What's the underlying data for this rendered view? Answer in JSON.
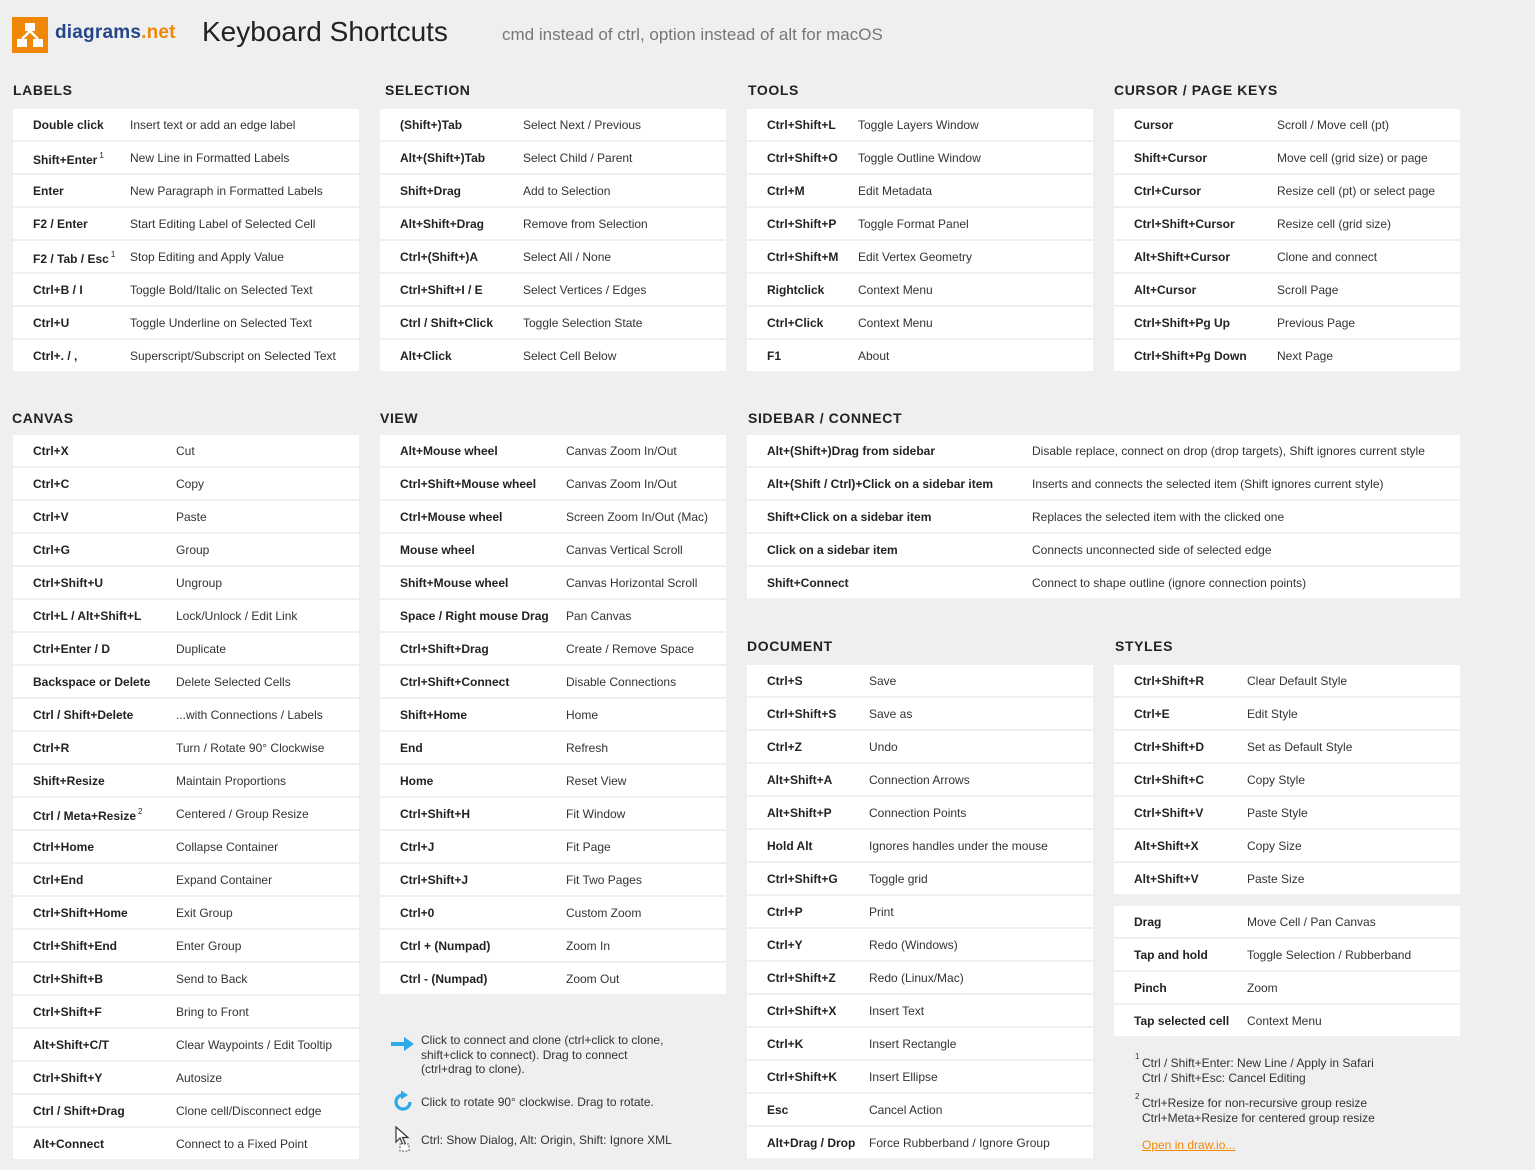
{
  "header": {
    "logo_main": "diagrams",
    "logo_ext": ".net",
    "title": "Keyboard Shortcuts",
    "subtitle": "cmd instead of ctrl, option instead of alt for macOS"
  },
  "sections": {
    "labels": {
      "title": "LABELS",
      "rows": [
        {
          "k": "Double click",
          "d": "Insert text or add an edge label"
        },
        {
          "k": "Shift+Enter",
          "sup": "1",
          "d": "New Line in Formatted Labels"
        },
        {
          "k": "Enter",
          "d": "New Paragraph in Formatted Labels"
        },
        {
          "k": "F2 / Enter",
          "d": "Start Editing Label of Selected Cell"
        },
        {
          "k": "F2 / Tab / Esc",
          "sup": "1",
          "d": "Stop Editing and Apply Value"
        },
        {
          "k": "Ctrl+B / I",
          "d": "Toggle Bold/Italic on Selected Text"
        },
        {
          "k": "Ctrl+U",
          "d": "Toggle Underline on Selected Text"
        },
        {
          "k": "Ctrl+. / ,",
          "d": "Superscript/Subscript on Selected Text"
        }
      ]
    },
    "selection": {
      "title": "SELECTION",
      "rows": [
        {
          "k": "(Shift+)Tab",
          "d": "Select Next / Previous"
        },
        {
          "k": "Alt+(Shift+)Tab",
          "d": "Select Child / Parent"
        },
        {
          "k": "Shift+Drag",
          "d": "Add to Selection"
        },
        {
          "k": "Alt+Shift+Drag",
          "d": "Remove from Selection"
        },
        {
          "k": "Ctrl+(Shift+)A",
          "d": "Select All / None"
        },
        {
          "k": "Ctrl+Shift+I / E",
          "d": "Select Vertices / Edges"
        },
        {
          "k": "Ctrl / Shift+Click",
          "d": "Toggle Selection State"
        },
        {
          "k": "Alt+Click",
          "d": "Select Cell Below"
        }
      ]
    },
    "tools": {
      "title": "TOOLS",
      "rows": [
        {
          "k": "Ctrl+Shift+L",
          "d": "Toggle Layers Window"
        },
        {
          "k": "Ctrl+Shift+O",
          "d": "Toggle Outline Window"
        },
        {
          "k": "Ctrl+M",
          "d": "Edit Metadata"
        },
        {
          "k": "Ctrl+Shift+P",
          "d": "Toggle Format Panel"
        },
        {
          "k": "Ctrl+Shift+M",
          "d": "Edit Vertex Geometry"
        },
        {
          "k": "Rightclick",
          "d": "Context Menu"
        },
        {
          "k": "Ctrl+Click",
          "d": "Context Menu"
        },
        {
          "k": "F1",
          "d": "About"
        }
      ]
    },
    "cursor": {
      "title": "CURSOR / PAGE KEYS",
      "rows": [
        {
          "k": "Cursor",
          "d": "Scroll / Move cell (pt)"
        },
        {
          "k": "Shift+Cursor",
          "d": "Move cell (grid size) or page"
        },
        {
          "k": "Ctrl+Cursor",
          "d": "Resize cell (pt) or select page"
        },
        {
          "k": "Ctrl+Shift+Cursor",
          "d": "Resize cell (grid size)"
        },
        {
          "k": "Alt+Shift+Cursor",
          "d": "Clone and connect"
        },
        {
          "k": "Alt+Cursor",
          "d": "Scroll Page"
        },
        {
          "k": "Ctrl+Shift+Pg Up",
          "d": "Previous Page"
        },
        {
          "k": "Ctrl+Shift+Pg Down",
          "d": "Next Page"
        }
      ]
    },
    "canvas": {
      "title": "CANVAS",
      "rows": [
        {
          "k": "Ctrl+X",
          "d": "Cut"
        },
        {
          "k": "Ctrl+C",
          "d": "Copy"
        },
        {
          "k": "Ctrl+V",
          "d": "Paste"
        },
        {
          "k": "Ctrl+G",
          "d": "Group"
        },
        {
          "k": "Ctrl+Shift+U",
          "d": "Ungroup"
        },
        {
          "k": "Ctrl+L / Alt+Shift+L",
          "d": "Lock/Unlock / Edit Link"
        },
        {
          "k": "Ctrl+Enter / D",
          "d": "Duplicate"
        },
        {
          "k": "Backspace or Delete",
          "d": "Delete Selected Cells"
        },
        {
          "k": "Ctrl / Shift+Delete",
          "d": "...with Connections / Labels"
        },
        {
          "k": "Ctrl+R",
          "d": "Turn / Rotate 90° Clockwise"
        },
        {
          "k": "Shift+Resize",
          "d": "Maintain Proportions"
        },
        {
          "k": "Ctrl / Meta+Resize",
          "sup": "2",
          "d": "Centered / Group Resize"
        },
        {
          "k": "Ctrl+Home",
          "d": "Collapse Container"
        },
        {
          "k": "Ctrl+End",
          "d": "Expand Container"
        },
        {
          "k": "Ctrl+Shift+Home",
          "d": "Exit Group"
        },
        {
          "k": "Ctrl+Shift+End",
          "d": "Enter Group"
        },
        {
          "k": "Ctrl+Shift+B",
          "d": "Send to Back"
        },
        {
          "k": "Ctrl+Shift+F",
          "d": "Bring to Front"
        },
        {
          "k": "Alt+Shift+C/T",
          "d": "Clear Waypoints / Edit Tooltip"
        },
        {
          "k": "Ctrl+Shift+Y",
          "d": "Autosize"
        },
        {
          "k": "Ctrl / Shift+Drag",
          "d": "Clone cell/Disconnect edge"
        },
        {
          "k": "Alt+Connect",
          "d": "Connect to a Fixed Point"
        }
      ]
    },
    "view": {
      "title": "VIEW",
      "rows": [
        {
          "k": "Alt+Mouse wheel",
          "d": "Canvas Zoom In/Out"
        },
        {
          "k": "Ctrl+Shift+Mouse wheel",
          "d": "Canvas Zoom In/Out"
        },
        {
          "k": "Ctrl+Mouse wheel",
          "d": "Screen Zoom In/Out (Mac)"
        },
        {
          "k": "Mouse wheel",
          "d": "Canvas Vertical Scroll"
        },
        {
          "k": "Shift+Mouse wheel",
          "d": "Canvas Horizontal Scroll"
        },
        {
          "k": "Space / Right mouse Drag",
          "d": "Pan Canvas"
        },
        {
          "k": "Ctrl+Shift+Drag",
          "d": "Create / Remove Space"
        },
        {
          "k": "Ctrl+Shift+Connect",
          "d": "Disable Connections"
        },
        {
          "k": "Shift+Home",
          "d": "Home"
        },
        {
          "k": "End",
          "d": "Refresh"
        },
        {
          "k": "Home",
          "d": "Reset View"
        },
        {
          "k": "Ctrl+Shift+H",
          "d": "Fit Window"
        },
        {
          "k": "Ctrl+J",
          "d": "Fit Page"
        },
        {
          "k": "Ctrl+Shift+J",
          "d": "Fit Two Pages"
        },
        {
          "k": "Ctrl+0",
          "d": "Custom Zoom"
        },
        {
          "k": "Ctrl + (Numpad)",
          "d": "Zoom In"
        },
        {
          "k": "Ctrl - (Numpad)",
          "d": "Zoom Out"
        }
      ]
    },
    "sidebar": {
      "title": "SIDEBAR / CONNECT",
      "rows": [
        {
          "k": "Alt+(Shift+)Drag from sidebar",
          "d": "Disable replace, connect on drop (drop targets), Shift ignores current style"
        },
        {
          "k": "Alt+(Shift / Ctrl)+Click on a sidebar item",
          "d": "Inserts and connects the selected item (Shift ignores current style)"
        },
        {
          "k": "Shift+Click on a sidebar item",
          "d": "Replaces the selected item with the clicked one"
        },
        {
          "k": "Click on a sidebar item",
          "d": "Connects unconnected side of selected edge"
        },
        {
          "k": "Shift+Connect",
          "d": "Connect to shape outline (ignore connection points)"
        }
      ]
    },
    "document": {
      "title": "DOCUMENT",
      "rows": [
        {
          "k": "Ctrl+S",
          "d": "Save"
        },
        {
          "k": "Ctrl+Shift+S",
          "d": "Save as"
        },
        {
          "k": "Ctrl+Z",
          "d": "Undo"
        },
        {
          "k": "Alt+Shift+A",
          "d": "Connection Arrows"
        },
        {
          "k": "Alt+Shift+P",
          "d": "Connection Points"
        },
        {
          "k": "Hold Alt",
          "d": "Ignores handles under the mouse"
        },
        {
          "k": "Ctrl+Shift+G",
          "d": "Toggle grid"
        },
        {
          "k": "Ctrl+P",
          "d": "Print"
        },
        {
          "k": "Ctrl+Y",
          "d": "Redo (Windows)"
        },
        {
          "k": "Ctrl+Shift+Z",
          "d": "Redo (Linux/Mac)"
        },
        {
          "k": "Ctrl+Shift+X",
          "d": "Insert Text"
        },
        {
          "k": "Ctrl+K",
          "d": "Insert Rectangle"
        },
        {
          "k": "Ctrl+Shift+K",
          "d": "Insert Ellipse"
        },
        {
          "k": "Esc",
          "d": "Cancel Action"
        },
        {
          "k": "Alt+Drag / Drop",
          "d": "Force Rubberband / Ignore Group"
        }
      ]
    },
    "styles": {
      "title": "STYLES",
      "rows": [
        {
          "k": "Ctrl+Shift+R",
          "d": "Clear Default Style"
        },
        {
          "k": "Ctrl+E",
          "d": "Edit Style"
        },
        {
          "k": "Ctrl+Shift+D",
          "d": "Set as Default Style"
        },
        {
          "k": "Ctrl+Shift+C",
          "d": "Copy Style"
        },
        {
          "k": "Ctrl+Shift+V",
          "d": "Paste Style"
        },
        {
          "k": "Alt+Shift+X",
          "d": "Copy Size"
        },
        {
          "k": "Alt+Shift+V",
          "d": "Paste Size"
        }
      ]
    },
    "touch": {
      "title": "",
      "rows": [
        {
          "k": "Drag",
          "d": "Move Cell / Pan Canvas"
        },
        {
          "k": "Tap and hold",
          "d": "Toggle Selection / Rubberband"
        },
        {
          "k": "Pinch",
          "d": "Zoom"
        },
        {
          "k": "Tap selected cell",
          "d": "Context Menu"
        }
      ]
    }
  },
  "tips": {
    "connect_line1": "Click to connect and clone (ctrl+click to clone,",
    "connect_line2": "shift+click to connect). Drag to connect",
    "connect_line3": "(ctrl+drag to clone).",
    "rotate": "Click to rotate 90° clockwise. Drag to rotate.",
    "cursor": "Ctrl: Show Dialog, Alt: Origin, Shift: Ignore XML"
  },
  "notes": {
    "n1_sup": "1",
    "n1_line1": "Ctrl / Shift+Enter: New Line / Apply in Safari",
    "n1_line2": "Ctrl / Shift+Esc: Cancel Editing",
    "n2_sup": "2",
    "n2_line1": "Ctrl+Resize for non-recursive group resize",
    "n2_line2": "Ctrl+Meta+Resize for centered group resize",
    "link": "Open in draw.io..."
  },
  "colors": {
    "accent": "#f08705",
    "brand": "#25468a",
    "tip_icon": "#2da8e8"
  }
}
